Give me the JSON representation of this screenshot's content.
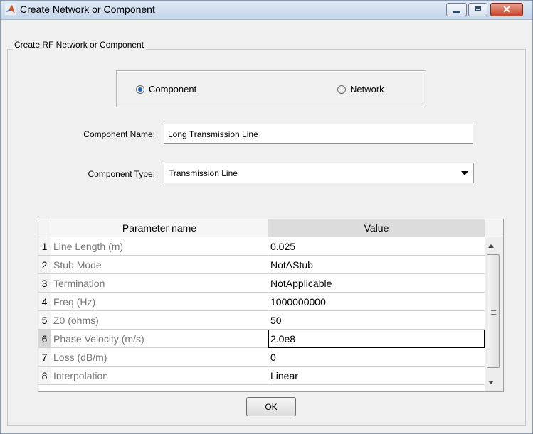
{
  "window": {
    "title": "Create Network or Component"
  },
  "group": {
    "label": "Create RF Network or Component"
  },
  "mode": {
    "options": [
      {
        "label": "Component",
        "checked": true
      },
      {
        "label": "Network",
        "checked": false
      }
    ]
  },
  "form": {
    "name_label": "Component Name:",
    "name_value": "Long Transmission Line",
    "type_label": "Component Type:",
    "type_value": "Transmission Line"
  },
  "table": {
    "headers": {
      "name": "Parameter name",
      "value": "Value"
    },
    "rows": [
      {
        "num": "1",
        "name": "Line Length (m)",
        "value": "0.025"
      },
      {
        "num": "2",
        "name": "Stub Mode",
        "value": "NotAStub"
      },
      {
        "num": "3",
        "name": "Termination",
        "value": "NotApplicable"
      },
      {
        "num": "4",
        "name": "Freq (Hz)",
        "value": "1000000000"
      },
      {
        "num": "5",
        "name": "Z0 (ohms)",
        "value": "50"
      },
      {
        "num": "6",
        "name": "Phase Velocity (m/s)",
        "value": "2.0e8"
      },
      {
        "num": "7",
        "name": "Loss (dB/m)",
        "value": "0"
      },
      {
        "num": "8",
        "name": "Interpolation",
        "value": "Linear"
      }
    ],
    "active_row": 6
  },
  "buttons": {
    "ok": "OK"
  },
  "colors": {
    "title_bar": "#c5d6ea",
    "close_button": "#c7432a",
    "radio_selected": "#1d62b8"
  },
  "icons": [
    "matlab-icon",
    "minimize-icon",
    "maximize-icon",
    "close-icon",
    "dropdown-arrow-icon",
    "scroll-up-icon",
    "scroll-down-icon"
  ]
}
